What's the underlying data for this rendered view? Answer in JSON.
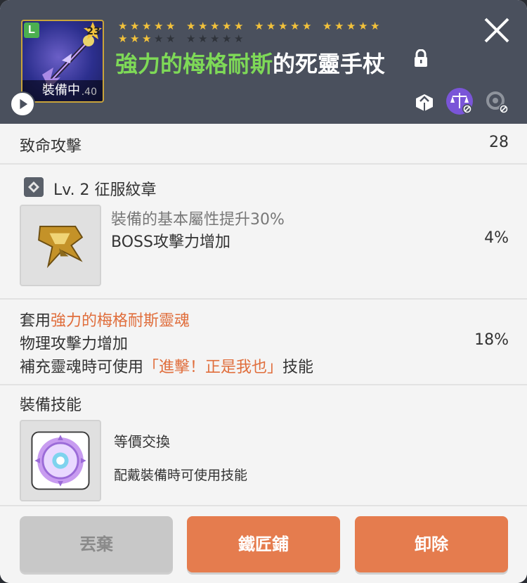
{
  "header": {
    "item_grade": "L",
    "item_level": "23",
    "equipped_label": "裝備中",
    "version_label": ".40",
    "stars_filled": 23,
    "stars_total": 30,
    "item_name_highlight": "強力的梅格耐斯",
    "item_name_rest": "的死靈手杖"
  },
  "stats": {
    "critical_label": "致命攻擊",
    "critical_value": "28"
  },
  "emblem": {
    "title": "Lv. 2 征服紋章",
    "desc": "裝備的基本屬性提升30%",
    "effect_label": "BOSS攻擊力增加",
    "effect_value": "4%"
  },
  "soul": {
    "prefix": "套用",
    "name": "強力的梅格耐斯靈魂",
    "effect_label": "物理攻擊力增加",
    "effect_value": "18%",
    "skill_prefix": "補充靈魂時可使用",
    "skill_name": "「進擊！正是我也」",
    "skill_suffix": "技能"
  },
  "equip_skill": {
    "section_title": "裝備技能",
    "skill_name": "等價交換",
    "skill_desc": "配戴裝備時可使用技能"
  },
  "footer": {
    "discard_label": "丟棄",
    "smith_label": "鐵匠鋪",
    "unequip_label": "卸除"
  },
  "colors": {
    "header_bg": "#4a505d",
    "star_on": "#f3c23b",
    "name_highlight": "#7ed957",
    "accent_orange": "#e57c4e",
    "text_orange": "#e06e3c"
  },
  "icons": [
    "play-icon",
    "lock-icon",
    "close-icon",
    "share-icon",
    "scale-icon",
    "refresh-blocked-icon",
    "diamond-icon",
    "emblem-icon",
    "skill-icon"
  ]
}
